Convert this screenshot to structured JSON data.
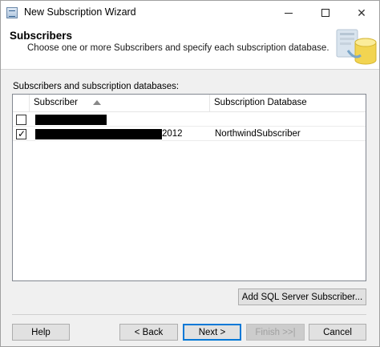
{
  "window": {
    "title": "New Subscription Wizard",
    "controls": {
      "minimize_glyph": "—",
      "maximize_glyph": "☐",
      "close_glyph": "✕"
    }
  },
  "header": {
    "title": "Subscribers",
    "subtitle": "Choose one or more Subscribers and specify each subscription database.",
    "graphic_icon": "database-wizard-graphic"
  },
  "subscribers_list": {
    "label": "Subscribers and subscription databases:",
    "columns": {
      "subscriber": "Subscriber",
      "database": "Subscription Database"
    },
    "sort": "ascending",
    "rows": [
      {
        "checked": false,
        "subscriber_visible_suffix": "",
        "database": ""
      },
      {
        "checked": true,
        "subscriber_visible_suffix": "2012",
        "database": "NorthwindSubscriber"
      }
    ]
  },
  "buttons": {
    "add_subscriber": "Add SQL Server Subscriber...",
    "help": "Help",
    "back": "< Back",
    "next": "Next >",
    "finish": "Finish >>|",
    "cancel": "Cancel"
  },
  "colors": {
    "accent": "#0078d7",
    "header_bg": "#ffffff",
    "dialog_bg": "#f0f0f0"
  }
}
